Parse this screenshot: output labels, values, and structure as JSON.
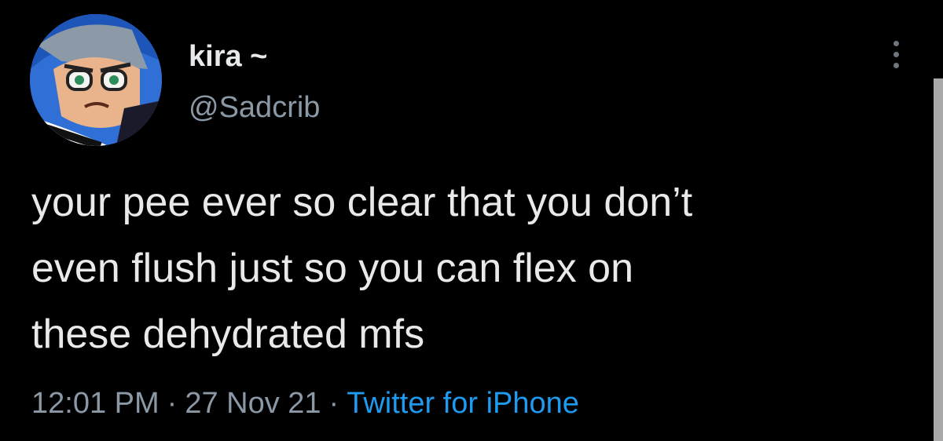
{
  "user": {
    "display_name": "kira ~",
    "handle": "@Sadcrib"
  },
  "tweet": {
    "text_lines": [
      "your pee ever so clear that you don’t",
      "even flush just so you can flex on",
      "these dehydrated mfs"
    ],
    "time": "12:01 PM",
    "date": "27 Nov 21",
    "separator": "·",
    "source": "Twitter for iPhone"
  },
  "icons": {
    "avatar": "cartoon-avatar-icon",
    "more": "more-options-icon"
  },
  "colors": {
    "background": "#000000",
    "text": "#e7e9ea",
    "secondary": "#8b98a5",
    "accent": "#1d9bf0"
  }
}
